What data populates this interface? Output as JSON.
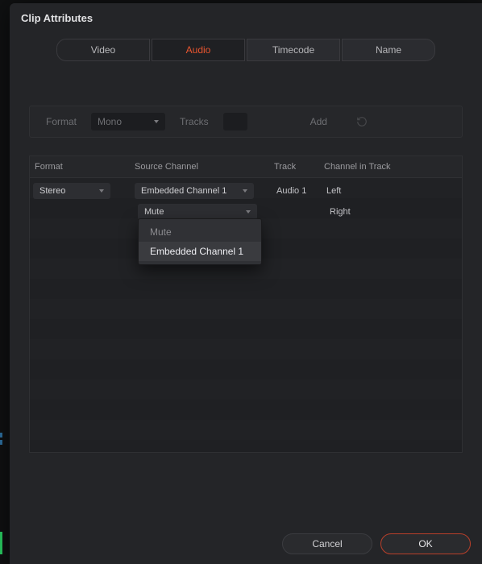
{
  "title": "Clip Attributes",
  "tabs": {
    "video": "Video",
    "audio": "Audio",
    "timecode": "Timecode",
    "name": "Name",
    "active": "audio"
  },
  "topbar": {
    "format_label": "Format",
    "format_value": "Mono",
    "tracks_label": "Tracks",
    "add_label": "Add"
  },
  "columns": {
    "format": "Format",
    "source": "Source Channel",
    "track": "Track",
    "cit": "Channel in Track"
  },
  "rows": [
    {
      "format": "Stereo",
      "source": "Embedded Channel 1",
      "track": "Audio 1",
      "cit": "Left"
    },
    {
      "source": "Mute",
      "cit": "Right"
    }
  ],
  "dropdown": {
    "opt1": "Mute",
    "opt2": "Embedded Channel 1"
  },
  "footer": {
    "cancel": "Cancel",
    "ok": "OK"
  }
}
